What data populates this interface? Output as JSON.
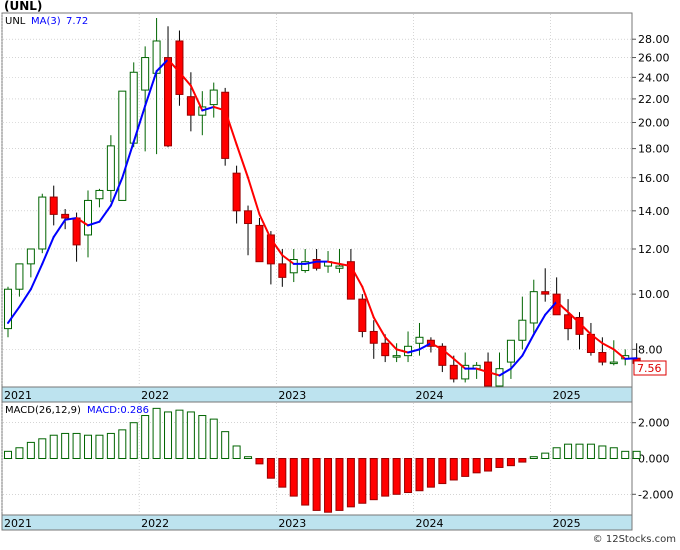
{
  "header": {
    "ticker": "(UNL)",
    "legend_symbol": "UNL",
    "legend_ma_label": "MA(3)",
    "legend_ma_value": "7.72",
    "last_price": "7.56"
  },
  "macd_panel": {
    "label": "MACD(26,12,9)",
    "value_label": "MACD:0.286"
  },
  "watermark": "© 12Stocks.com",
  "colors": {
    "up_candle": "#006400",
    "down_candle": "#ff0000",
    "ma_up": "#0000ff",
    "ma_down": "#ff0000",
    "axis_band": "#bde3ef",
    "grid": "#bbbbbb",
    "price_badge": "#dd0000"
  },
  "chart_data": [
    {
      "type": "candlestick",
      "title": "(UNL)",
      "interval": "monthly",
      "scale": "log",
      "ylim": [
        6.9,
        31.0
      ],
      "y_ticks": [
        8,
        10,
        12,
        14,
        16,
        18,
        20,
        22,
        24,
        26,
        28
      ],
      "y_tick_labels": [
        "8.00",
        "10.00",
        "12.00",
        "14.00",
        "16.00",
        "18.00",
        "20.00",
        "22.00",
        "24.00",
        "26.00",
        "28.00"
      ],
      "x_tick_labels": [
        "2021",
        "2022",
        "2023",
        "2024",
        "2025"
      ],
      "x_tick_index": [
        0,
        12,
        24,
        36,
        48
      ],
      "grid": true,
      "legend": "top-left",
      "series": [
        {
          "name": "UNL",
          "months": [
            "2021-01",
            "2021-02",
            "2021-03",
            "2021-04",
            "2021-05",
            "2021-06",
            "2021-07",
            "2021-08",
            "2021-09",
            "2021-10",
            "2021-11",
            "2021-12",
            "2022-01",
            "2022-02",
            "2022-03",
            "2022-04",
            "2022-05",
            "2022-06",
            "2022-07",
            "2022-08",
            "2022-09",
            "2022-10",
            "2022-11",
            "2022-12",
            "2023-01",
            "2023-02",
            "2023-03",
            "2023-04",
            "2023-05",
            "2023-06",
            "2023-07",
            "2023-08",
            "2023-09",
            "2023-10",
            "2023-11",
            "2023-12",
            "2024-01",
            "2024-02",
            "2024-03",
            "2024-04",
            "2024-05",
            "2024-06",
            "2024-07",
            "2024-08",
            "2024-09",
            "2024-10",
            "2024-11",
            "2024-12",
            "2025-01",
            "2025-02",
            "2025-03",
            "2025-04",
            "2025-05",
            "2025-06",
            "2025-07",
            "2025-08"
          ],
          "open": [
            8.7,
            10.2,
            11.3,
            12.0,
            14.8,
            13.8,
            13.6,
            12.7,
            14.7,
            15.2,
            14.6,
            18.4,
            22.8,
            24.4,
            26.0,
            27.8,
            22.2,
            20.6,
            21.5,
            22.6,
            16.3,
            14.0,
            13.2,
            12.7,
            11.3,
            10.9,
            11.0,
            11.5,
            11.2,
            11.1,
            11.4,
            9.8,
            8.6,
            8.2,
            7.8,
            7.8,
            8.2,
            8.3,
            8.1,
            7.5,
            7.1,
            7.4,
            7.6,
            6.9,
            7.6,
            8.3,
            8.9,
            10.1,
            10.0,
            9.2,
            9.1,
            8.5,
            7.9,
            7.6,
            7.7,
            7.72
          ],
          "high": [
            10.3,
            11.2,
            12.0,
            15.0,
            15.5,
            14.1,
            13.9,
            15.2,
            15.3,
            19.0,
            22.6,
            25.5,
            27.2,
            30.5,
            29.5,
            29.0,
            24.5,
            22.7,
            23.5,
            23.0,
            16.8,
            14.3,
            13.6,
            12.9,
            12.0,
            12.0,
            12.0,
            12.0,
            11.9,
            12.0,
            12.0,
            10.0,
            9.0,
            8.5,
            8.2,
            8.6,
            8.9,
            8.4,
            8.2,
            7.8,
            7.9,
            7.6,
            7.9,
            7.9,
            8.3,
            9.9,
            10.6,
            11.1,
            10.7,
            9.8,
            9.3,
            8.9,
            8.4,
            8.3,
            8.0,
            8.2
          ],
          "low": [
            8.4,
            9.9,
            10.7,
            11.8,
            13.2,
            13.0,
            11.4,
            11.6,
            14.2,
            14.5,
            14.6,
            18.1,
            17.8,
            17.6,
            18.1,
            21.4,
            19.3,
            19.0,
            20.4,
            16.8,
            13.3,
            11.7,
            11.4,
            10.4,
            10.3,
            10.5,
            10.9,
            11.0,
            10.9,
            10.9,
            10.4,
            8.4,
            7.7,
            7.6,
            7.6,
            7.6,
            7.8,
            7.9,
            7.3,
            7.0,
            7.0,
            7.1,
            6.9,
            6.8,
            7.1,
            8.0,
            8.5,
            9.7,
            9.3,
            8.3,
            8.0,
            7.8,
            7.5,
            7.5,
            7.5,
            7.4
          ],
          "close": [
            10.2,
            11.3,
            12.0,
            14.8,
            13.8,
            13.6,
            12.2,
            14.6,
            15.2,
            18.2,
            22.7,
            24.5,
            26.0,
            27.8,
            18.2,
            22.4,
            20.6,
            21.3,
            22.8,
            17.3,
            14.0,
            13.3,
            11.4,
            11.3,
            10.7,
            11.5,
            11.4,
            11.1,
            11.4,
            11.2,
            9.8,
            8.6,
            8.2,
            7.8,
            7.8,
            8.1,
            8.4,
            8.1,
            7.5,
            7.1,
            7.5,
            7.5,
            6.9,
            7.4,
            8.3,
            9.0,
            10.1,
            10.0,
            9.2,
            8.7,
            8.5,
            7.9,
            7.6,
            7.6,
            7.8,
            7.56
          ],
          "ma3": [
            8.9,
            9.5,
            10.2,
            11.3,
            12.6,
            13.5,
            13.6,
            13.2,
            13.4,
            14.3,
            16.0,
            18.5,
            21.4,
            24.6,
            25.8,
            24.5,
            23.2,
            21.0,
            21.3,
            21.0,
            18.3,
            16.0,
            13.8,
            12.5,
            11.7,
            11.3,
            11.3,
            11.4,
            11.4,
            11.3,
            11.2,
            10.3,
            9.1,
            8.4,
            8.0,
            7.9,
            8.0,
            8.2,
            8.0,
            7.7,
            7.4,
            7.4,
            7.3,
            7.2,
            7.4,
            7.8,
            8.5,
            9.2,
            9.7,
            9.3,
            8.9,
            8.5,
            8.2,
            8.0,
            7.7,
            7.72
          ]
        }
      ]
    },
    {
      "type": "bar",
      "title": "MACD(26,12,9)",
      "ylim": [
        -3.1,
        3.1
      ],
      "y_ticks": [
        2,
        0,
        -2
      ],
      "y_tick_labels": [
        "2.000",
        "0.000",
        "-2.000"
      ],
      "x_tick_labels": [
        "2021",
        "2022",
        "2023",
        "2024",
        "2025"
      ],
      "x_tick_index": [
        0,
        12,
        24,
        36,
        48
      ],
      "grid": true,
      "series": [
        {
          "name": "MACD",
          "values": [
            0.4,
            0.6,
            0.9,
            1.1,
            1.3,
            1.4,
            1.4,
            1.3,
            1.3,
            1.4,
            1.6,
            2.0,
            2.4,
            2.8,
            2.6,
            2.7,
            2.6,
            2.4,
            2.2,
            1.5,
            0.7,
            0.1,
            -0.3,
            -1.1,
            -1.6,
            -2.1,
            -2.6,
            -2.9,
            -3.0,
            -2.9,
            -2.7,
            -2.5,
            -2.3,
            -2.1,
            -2.0,
            -1.9,
            -1.8,
            -1.6,
            -1.4,
            -1.2,
            -1.0,
            -0.8,
            -0.7,
            -0.5,
            -0.4,
            -0.2,
            0.1,
            0.3,
            0.6,
            0.8,
            0.8,
            0.8,
            0.7,
            0.6,
            0.4,
            0.4
          ]
        }
      ]
    }
  ]
}
